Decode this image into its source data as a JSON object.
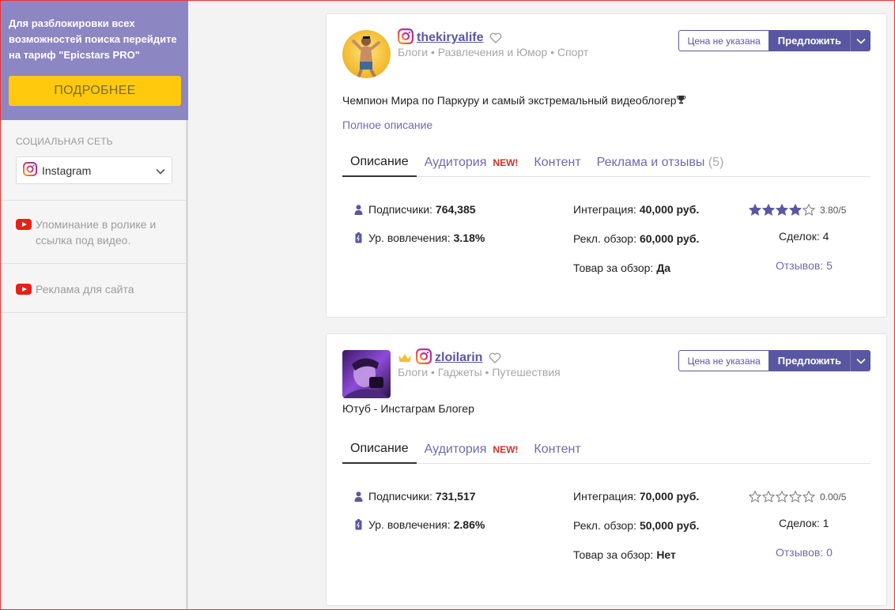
{
  "sidebar": {
    "promo_text": "Для разблокировки всех возможностей поиска перейдите на тариф \"Epicstars PRO\"",
    "promo_button": "ПОДРОБНЕЕ",
    "social_label": "СОЦИАЛЬНАЯ СЕТЬ",
    "social_value": "Instagram",
    "youtube_mention": "Упоминание в ролике и ссылка под видео.",
    "youtube_ads": "Реклама для сайта"
  },
  "cards": [
    {
      "name": "thekiryalife",
      "categories": "Блоги • Развлечения и Юмор • Спорт",
      "price_label": "Цена не указана",
      "offer_label": "Предложить",
      "description": "Чемпион Мира по Паркуру и самый экстремальный видеоблогер",
      "more_label": "Полное описание",
      "tabs": {
        "desc": "Описание",
        "audience": "Аудитория",
        "new": "NEW!",
        "content": "Контент",
        "ads": "Реклама и отзывы",
        "ads_count": "(5)"
      },
      "subs_label": "Подписчики:",
      "subs": "764,385",
      "eng_label": "Ур. вовлечения:",
      "eng": "3.18%",
      "integration_label": "Интеграция:",
      "integration": "40,000 руб.",
      "review_label": "Рекл. обзор:",
      "review": "60,000 руб.",
      "goods_label": "Товар за обзор:",
      "goods": "Да",
      "rating": 3.8,
      "rating_text": "3.80/5",
      "deals": "Сделок: 4",
      "reviews": "Отзывов: 5"
    },
    {
      "name": "zloilarin",
      "categories": "Блоги • Гаджеты • Путешествия",
      "price_label": "Цена не указана",
      "offer_label": "Предложить",
      "description": "Ютуб - Инстаграм Блогер",
      "tabs": {
        "desc": "Описание",
        "audience": "Аудитория",
        "new": "NEW!",
        "content": "Контент"
      },
      "subs_label": "Подписчики:",
      "subs": "731,517",
      "eng_label": "Ур. вовлечения:",
      "eng": "2.86%",
      "integration_label": "Интеграция:",
      "integration": "70,000 руб.",
      "review_label": "Рекл. обзор:",
      "review": "50,000 руб.",
      "goods_label": "Товар за обзор:",
      "goods": "Нет",
      "rating": 0,
      "rating_text": "0.00/5",
      "deals": "Сделок: 1",
      "reviews": "Отзывов: 0"
    }
  ],
  "colors": {
    "accent": "#5a57a2",
    "promo_bg": "#8c86c2",
    "promo_button": "#ffc90e",
    "new_badge": "#d0322a",
    "star": "#5a57a2"
  },
  "icons": [
    "instagram-icon",
    "youtube-icon",
    "heart-icon",
    "crown-icon",
    "user-icon",
    "battery-icon",
    "star-icon",
    "chevron-down-icon",
    "trophy-icon"
  ]
}
